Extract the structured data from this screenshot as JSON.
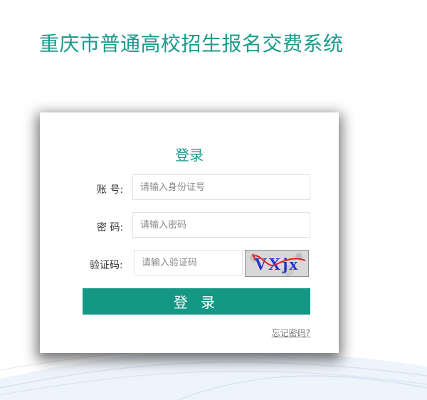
{
  "header": {
    "title": "重庆市普通高校招生报名交费系统"
  },
  "login": {
    "title": "登录",
    "account_label": "账  号:",
    "account_placeholder": "请输入身份证号",
    "password_label": "密  码:",
    "password_placeholder": "请输入密码",
    "captcha_label": "验证码:",
    "captcha_placeholder": "请输入验证码",
    "captcha_text": "VXjx",
    "submit_label": "登 录",
    "forgot_label": "忘记密码?"
  },
  "colors": {
    "brand": "#1a9a8a",
    "button": "#159785"
  }
}
